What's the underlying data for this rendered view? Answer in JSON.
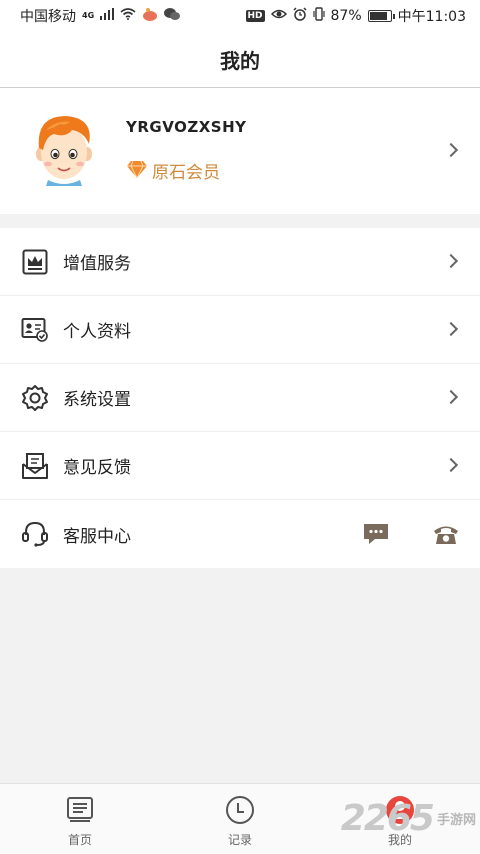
{
  "status_bar": {
    "carrier": "中国移动",
    "network": "4G",
    "battery": "87%",
    "battery_level": 0.87,
    "time": "中午11:03",
    "hd": "HD"
  },
  "header": {
    "title": "我的"
  },
  "profile": {
    "username": "YRGVOZXSHY",
    "member_label": "原石会员",
    "member_color": "#d08a3e"
  },
  "menu": {
    "items": [
      {
        "label": "增值服务",
        "icon": "crown-icon"
      },
      {
        "label": "个人资料",
        "icon": "id-card-icon"
      },
      {
        "label": "系统设置",
        "icon": "gear-icon"
      },
      {
        "label": "意见反馈",
        "icon": "envelope-icon"
      },
      {
        "label": "客服中心",
        "icon": "headset-icon"
      }
    ]
  },
  "tabbar": {
    "items": [
      {
        "label": "首页",
        "icon": "home-icon"
      },
      {
        "label": "记录",
        "icon": "clock-icon"
      },
      {
        "label": "我的",
        "icon": "user-icon",
        "active": true
      }
    ]
  },
  "watermark": {
    "number": "2265",
    "text": "手游网"
  },
  "colors": {
    "accent": "#d08a3e",
    "background": "#f2f2f2"
  }
}
